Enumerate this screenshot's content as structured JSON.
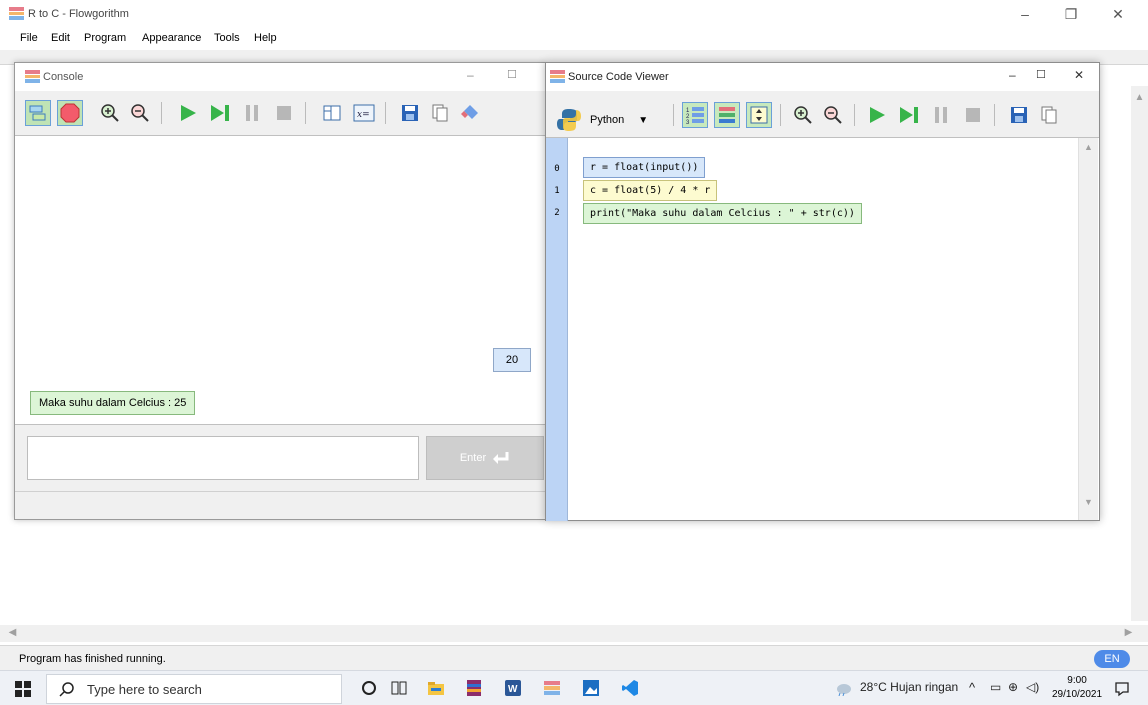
{
  "window": {
    "title": "R to C - Flowgorithm"
  },
  "menu": [
    "File",
    "Edit",
    "Program",
    "Appearance",
    "Tools",
    "Help"
  ],
  "console": {
    "title": "Console",
    "output": "Maka suhu dalam Celcius : 25",
    "input_echo": "20",
    "input_value": "",
    "enter_label": "Enter"
  },
  "viewer": {
    "title": "Source Code Viewer",
    "language": "Python",
    "lines": [
      {
        "num": "0",
        "code": "r = float(input())"
      },
      {
        "num": "1",
        "code": "c = float(5) / 4 * r"
      },
      {
        "num": "2",
        "code": "print(\"Maka suhu dalam Celcius : \" + str(c))"
      }
    ]
  },
  "status": {
    "text": "Program has finished running.",
    "lang": "EN"
  },
  "taskbar": {
    "search_placeholder": "Type here to search",
    "weather": "28°C  Hujan ringan",
    "time": "9:00",
    "date": "29/10/2021"
  },
  "colors": {
    "accent": "#4f8be8",
    "input_bubble": "#d7e7fa",
    "output_bubble": "#dcf5d6",
    "gutter": "#bcd4f5"
  }
}
